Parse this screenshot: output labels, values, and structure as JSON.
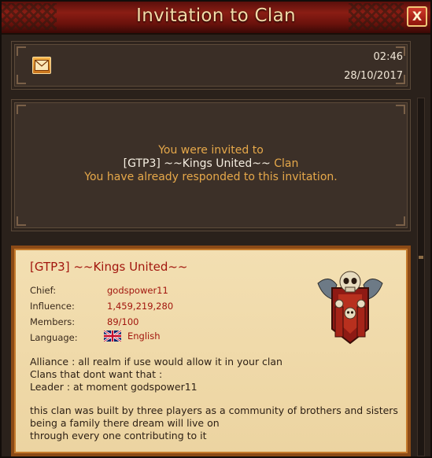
{
  "window": {
    "title": "Invitation to Clan",
    "close_label": "X"
  },
  "header": {
    "time": "02:46",
    "date": "28/10/2017",
    "icon": "mail-icon"
  },
  "message": {
    "line1": "You were invited to",
    "clan_tag": "[GTP3] ~~Kings United~~",
    "clan_word": " Clan",
    "line3": "You have already responded to this invitation."
  },
  "clan": {
    "name": "[GTP3] ~~Kings United~~",
    "fields": [
      {
        "label": "Chief:",
        "value": "godspower11"
      },
      {
        "label": "Influence:",
        "value": "1,459,219,280"
      },
      {
        "label": "Members:",
        "value": "89/100"
      },
      {
        "label": "Language:",
        "value": "English",
        "flag": "uk-flag-icon"
      }
    ],
    "description": [
      "Alliance : all realm if use would allow it in your clan",
      "Clans that dont want that :",
      "Leader : at moment godspower11",
      "this clan was built by three players as a community of brothers and sisters being a family there dream will live on",
      "through every one contributing to it"
    ],
    "emblem": "skull-banner-emblem"
  },
  "colors": {
    "title_bar": "#8a1d14",
    "title_text": "#f4dca8",
    "accent_red": "#a2160e",
    "message_orange": "#e6a84a",
    "card_bg": "#f3dfb2"
  }
}
